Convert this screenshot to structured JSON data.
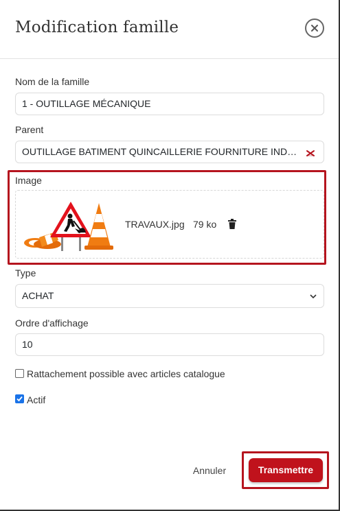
{
  "modal": {
    "title": "Modification famille"
  },
  "form": {
    "name": {
      "label": "Nom de la famille",
      "value": "1 - OUTILLAGE MÉCANIQUE"
    },
    "parent": {
      "label": "Parent",
      "value": "OUTILLAGE BATIMENT QUINCAILLERIE FOURNITURE INDUSTRI..."
    },
    "image": {
      "label": "Image",
      "file_name": "TRAVAUX.jpg",
      "file_size": "79 ko"
    },
    "type": {
      "label": "Type",
      "value": "ACHAT"
    },
    "order": {
      "label": "Ordre d'affichage",
      "value": "10"
    },
    "catalog_link": {
      "label": "Rattachement possible avec articles catalogue",
      "checked": false
    },
    "active": {
      "label": "Actif",
      "checked": true
    }
  },
  "footer": {
    "cancel_label": "Annuler",
    "submit_label": "Transmettre"
  },
  "colors": {
    "primary": "#c0121c",
    "highlight_border": "#b5141e",
    "checkbox_checked": "#1a73e8"
  },
  "icons": [
    "close-icon",
    "clear-icon",
    "chevron-down-icon",
    "trash-icon",
    "check-icon"
  ]
}
